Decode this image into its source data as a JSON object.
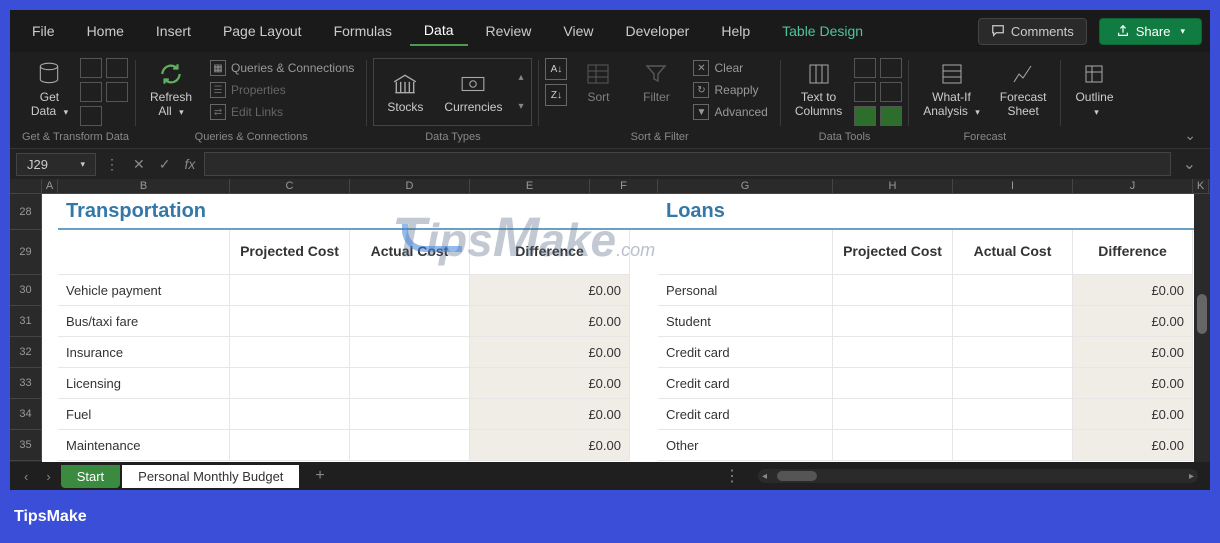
{
  "menu": {
    "items": [
      "File",
      "Home",
      "Insert",
      "Page Layout",
      "Formulas",
      "Data",
      "Review",
      "View",
      "Developer",
      "Help",
      "Table Design"
    ],
    "active": "Data",
    "comments": "Comments",
    "share": "Share"
  },
  "ribbon": {
    "g1": {
      "getdata": "Get\nData",
      "label": "Get & Transform Data"
    },
    "g2": {
      "refresh": "Refresh\nAll",
      "qc": "Queries & Connections",
      "props": "Properties",
      "links": "Edit Links",
      "label": "Queries & Connections"
    },
    "g3": {
      "stocks": "Stocks",
      "curr": "Currencies",
      "label": "Data Types"
    },
    "g4": {
      "sort": "Sort",
      "filter": "Filter",
      "clear": "Clear",
      "reapply": "Reapply",
      "adv": "Advanced",
      "label": "Sort & Filter"
    },
    "g5": {
      "t2c": "Text to\nColumns",
      "label": "Data Tools"
    },
    "g6": {
      "whatif": "What-If\nAnalysis",
      "fs": "Forecast\nSheet",
      "label": "Forecast"
    },
    "g7": {
      "outline": "Outline"
    }
  },
  "namebox": "J29",
  "cols": [
    "A",
    "B",
    "C",
    "D",
    "E",
    "F",
    "G",
    "H",
    "I",
    "J",
    "K"
  ],
  "rows": [
    "28",
    "29",
    "30",
    "31",
    "32",
    "33",
    "34",
    "35"
  ],
  "left": {
    "title": "Transportation",
    "h1": "Projected Cost",
    "h2": "Actual Cost",
    "h3": "Difference",
    "items": [
      "Vehicle payment",
      "Bus/taxi fare",
      "Insurance",
      "Licensing",
      "Fuel",
      "Maintenance"
    ],
    "diff": [
      "£0.00",
      "£0.00",
      "£0.00",
      "£0.00",
      "£0.00",
      "£0.00"
    ]
  },
  "right": {
    "title": "Loans",
    "h1": "Projected Cost",
    "h2": "Actual Cost",
    "h3": "Difference",
    "items": [
      "Personal",
      "Student",
      "Credit card",
      "Credit card",
      "Credit card",
      "Other"
    ],
    "diff": [
      "£0.00",
      "£0.00",
      "£0.00",
      "£0.00",
      "£0.00",
      "£0.00"
    ]
  },
  "tabs": {
    "start": "Start",
    "active": "Personal Monthly Budget"
  },
  "watermark": {
    "a": "T",
    "b": "ips",
    "c": "M",
    "d": "ake",
    "e": ".com"
  },
  "footer": "TipsMake"
}
